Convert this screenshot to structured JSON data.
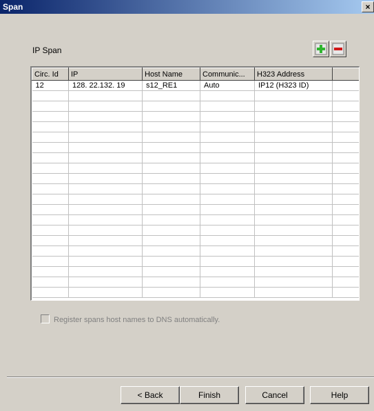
{
  "window": {
    "title": "Span",
    "close_glyph": "×"
  },
  "section": {
    "label": "IP Span"
  },
  "toolbar": {
    "add_icon": "add-icon",
    "remove_icon": "remove-icon",
    "add_color": "#2fb52f",
    "remove_color": "#d01818"
  },
  "table": {
    "columns": [
      "Circ. Id",
      "IP",
      "Host Name",
      "Communic...",
      "H323 Address",
      ""
    ],
    "rows": [
      [
        "12",
        "128.  22.132.  19",
        "s12_RE1",
        "Auto",
        "IP12 (H323 ID)",
        ""
      ],
      [
        "",
        "",
        "",
        "",
        "",
        ""
      ],
      [
        "",
        "",
        "",
        "",
        "",
        ""
      ],
      [
        "",
        "",
        "",
        "",
        "",
        ""
      ],
      [
        "",
        "",
        "",
        "",
        "",
        ""
      ],
      [
        "",
        "",
        "",
        "",
        "",
        ""
      ],
      [
        "",
        "",
        "",
        "",
        "",
        ""
      ],
      [
        "",
        "",
        "",
        "",
        "",
        ""
      ],
      [
        "",
        "",
        "",
        "",
        "",
        ""
      ],
      [
        "",
        "",
        "",
        "",
        "",
        ""
      ],
      [
        "",
        "",
        "",
        "",
        "",
        ""
      ],
      [
        "",
        "",
        "",
        "",
        "",
        ""
      ],
      [
        "",
        "",
        "",
        "",
        "",
        ""
      ],
      [
        "",
        "",
        "",
        "",
        "",
        ""
      ],
      [
        "",
        "",
        "",
        "",
        "",
        ""
      ],
      [
        "",
        "",
        "",
        "",
        "",
        ""
      ],
      [
        "",
        "",
        "",
        "",
        "",
        ""
      ],
      [
        "",
        "",
        "",
        "",
        "",
        ""
      ],
      [
        "",
        "",
        "",
        "",
        "",
        ""
      ],
      [
        "",
        "",
        "",
        "",
        "",
        ""
      ],
      [
        "",
        "",
        "",
        "",
        "",
        ""
      ]
    ]
  },
  "options": {
    "register_dns_label": "Register spans host names to DNS automatically.",
    "register_dns_checked": false,
    "register_dns_enabled": false
  },
  "buttons": {
    "back": "< Back",
    "finish": "Finish",
    "cancel": "Cancel",
    "help": "Help"
  }
}
